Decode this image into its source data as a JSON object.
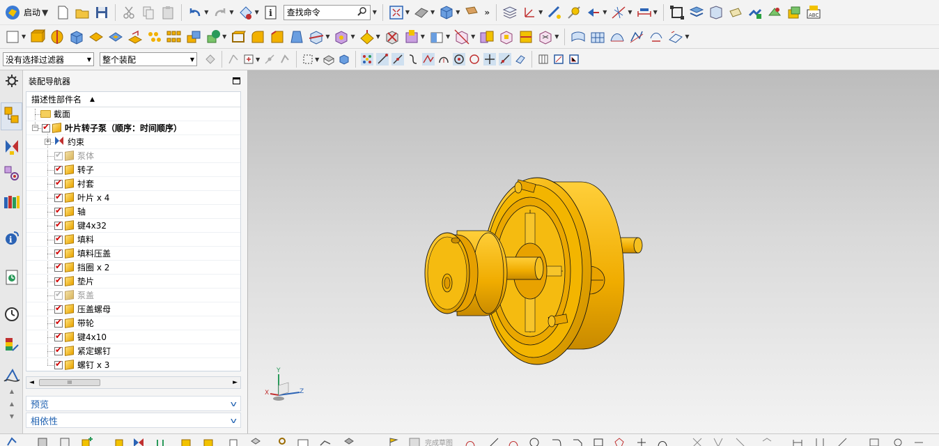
{
  "toolbar": {
    "start_label": "启动",
    "find_command_placeholder": "查找命令",
    "selection_filter": "没有选择过滤器",
    "assembly_scope": "整个装配",
    "overflow": "»"
  },
  "navigator": {
    "title": "装配导航器",
    "column_header": "描述性部件名",
    "section_label": "截面",
    "root": {
      "label": "叶片转子泵（顺序：时间顺序）",
      "checked": true
    },
    "constraints_label": "约束",
    "parts": [
      {
        "label": "泵体",
        "checked": true,
        "dimmed": true
      },
      {
        "label": "转子",
        "checked": true,
        "dimmed": false
      },
      {
        "label": "衬套",
        "checked": true,
        "dimmed": false
      },
      {
        "label": "叶片 x 4",
        "checked": true,
        "dimmed": false
      },
      {
        "label": "轴",
        "checked": true,
        "dimmed": false
      },
      {
        "label": "键4x32",
        "checked": true,
        "dimmed": false
      },
      {
        "label": "填料",
        "checked": true,
        "dimmed": false
      },
      {
        "label": "填料压盖",
        "checked": true,
        "dimmed": false
      },
      {
        "label": "挡圈 x 2",
        "checked": true,
        "dimmed": false
      },
      {
        "label": "垫片",
        "checked": true,
        "dimmed": false
      },
      {
        "label": "泵盖",
        "checked": true,
        "dimmed": true
      },
      {
        "label": "压盖螺母",
        "checked": true,
        "dimmed": false
      },
      {
        "label": "带轮",
        "checked": true,
        "dimmed": false
      },
      {
        "label": "键4x10",
        "checked": true,
        "dimmed": false
      },
      {
        "label": "紧定螺钉",
        "checked": true,
        "dimmed": false
      },
      {
        "label": "螺钉 x 3",
        "checked": true,
        "dimmed": false
      }
    ],
    "scroll_thumb_label": "III",
    "preview_label": "预览",
    "dependency_label": "相依性"
  },
  "viewport": {
    "triad": {
      "x_label": "X",
      "y_label": "Y",
      "z_label": "Z"
    },
    "model_color": "#f2b100"
  },
  "bottom_toolbar": {
    "finish_sketch_label": "完成草图"
  },
  "colors": {
    "accent_blue": "#1c5fb0",
    "check_red": "#d00000",
    "part_gold": "#e8a400"
  }
}
